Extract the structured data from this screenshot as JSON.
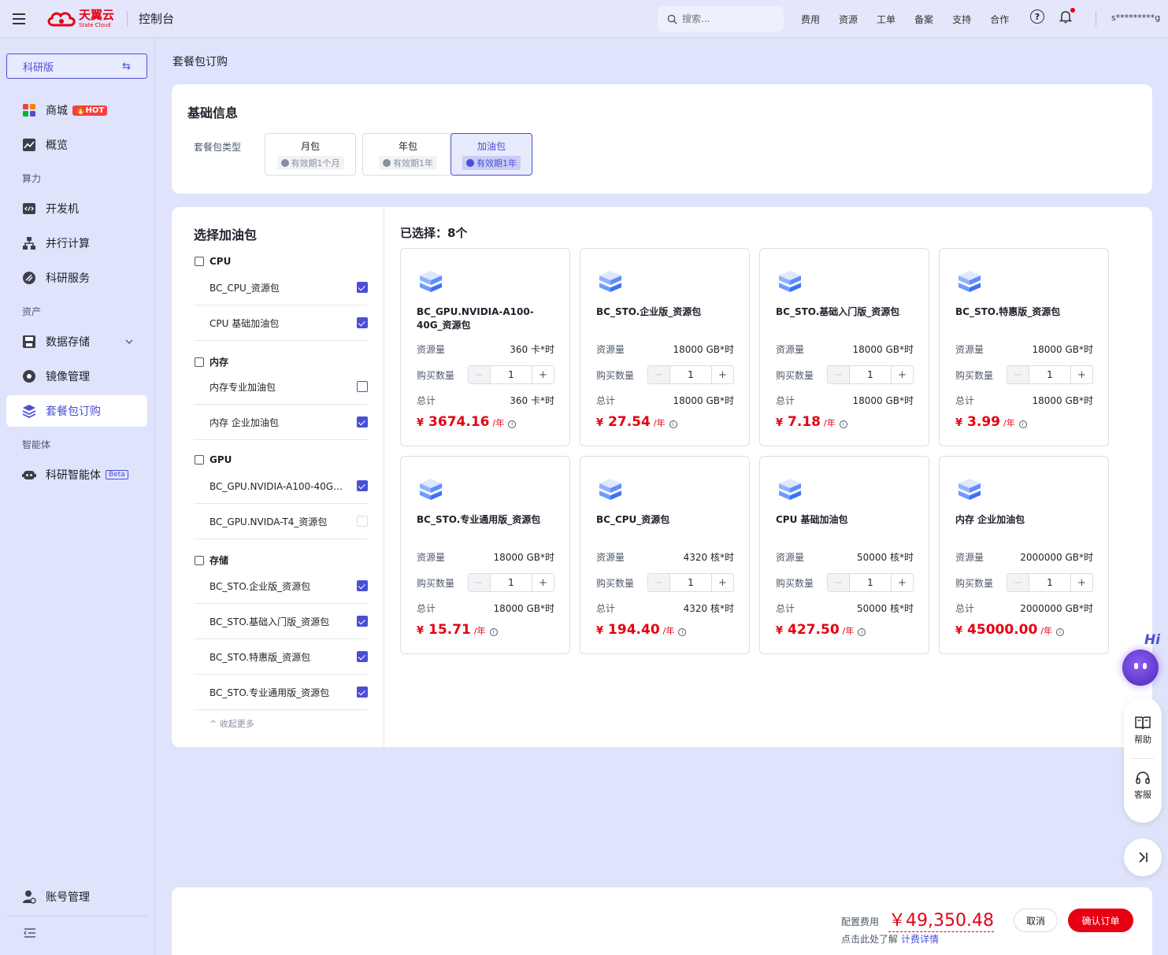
{
  "topbar": {
    "logo_cn": "天翼云",
    "logo_en": "State Cloud",
    "console_title": "控制台",
    "search_placeholder": "搜索...",
    "nav": [
      "费用",
      "资源",
      "工单",
      "备案",
      "支持",
      "合作"
    ],
    "help_glyph": "?",
    "username": "s*********g",
    "brand_color": "#e60012"
  },
  "sidebar": {
    "edition": "科研版",
    "edition_switch_glyph": "⇆",
    "items": [
      {
        "label": "商城",
        "badge": "🔥HOT",
        "icon": "apps-icon"
      },
      {
        "label": "概览",
        "icon": "chart-icon"
      },
      {
        "label": "开发机",
        "icon": "code-icon"
      },
      {
        "label": "并行计算",
        "icon": "cluster-icon"
      },
      {
        "label": "科研服务",
        "icon": "flask-icon"
      },
      {
        "label": "数据存储",
        "icon": "disk-icon"
      },
      {
        "label": "镜像管理",
        "icon": "image-icon"
      },
      {
        "label": "套餐包订购",
        "icon": "layers-icon"
      },
      {
        "label": "科研智能体",
        "badge": "Beta",
        "icon": "robot-icon"
      },
      {
        "label": "账号管理",
        "icon": "user-icon"
      }
    ],
    "groups": [
      "算力",
      "资产",
      "智能体"
    ],
    "active_item": "套餐包订购",
    "active_color": "#4a4fd6"
  },
  "breadcrumb": "套餐包订购",
  "basic": {
    "title": "基础信息",
    "type_label": "套餐包类型",
    "options": [
      {
        "name": "月包",
        "validity": "有效期1个月"
      },
      {
        "name": "年包",
        "validity": "有效期1年"
      },
      {
        "name": "加油包",
        "validity": "有效期1年"
      }
    ],
    "selected": "加油包"
  },
  "select_panel": {
    "title": "选择加油包",
    "categories": [
      {
        "name": "CPU",
        "items": [
          {
            "label": "BC_CPU_资源包",
            "checked": true
          },
          {
            "label": "CPU 基础加油包",
            "checked": true
          }
        ]
      },
      {
        "name": "内存",
        "items": [
          {
            "label": "内存专业加油包",
            "checked": false
          },
          {
            "label": "内存 企业加油包",
            "checked": true
          }
        ]
      },
      {
        "name": "GPU",
        "items": [
          {
            "label": "BC_GPU.NVIDIA-A100-40G_资源包",
            "checked": true
          },
          {
            "label": "BC_GPU.NVIDA-T4_资源包",
            "checked": false,
            "disabled": true
          }
        ]
      },
      {
        "name": "存储",
        "items": [
          {
            "label": "BC_STO.企业版_资源包",
            "checked": true
          },
          {
            "label": "BC_STO.基础入门版_资源包",
            "checked": true
          },
          {
            "label": "BC_STO.特惠版_资源包",
            "checked": true
          },
          {
            "label": "BC_STO.专业通用版_资源包",
            "checked": true
          }
        ]
      }
    ],
    "collapse_label": "收起更多"
  },
  "selected": {
    "title": "已选择：8个",
    "labels": {
      "resource": "资源量",
      "quantity": "购买数量",
      "total": "总计",
      "currency": "¥",
      "per_year": "/年",
      "minus": "−",
      "plus": "+",
      "info": "i"
    },
    "products": [
      {
        "name": "BC_GPU.NVIDIA-A100-40G_资源包",
        "resource": "360 卡*时",
        "quantity": "1",
        "total": "360 卡*时",
        "price": "3674.16"
      },
      {
        "name": "BC_STO.企业版_资源包",
        "resource": "18000 GB*时",
        "quantity": "1",
        "total": "18000 GB*时",
        "price": "27.54"
      },
      {
        "name": "BC_STO.基础入门版_资源包",
        "resource": "18000 GB*时",
        "quantity": "1",
        "total": "18000 GB*时",
        "price": "7.18"
      },
      {
        "name": "BC_STO.特惠版_资源包",
        "resource": "18000 GB*时",
        "quantity": "1",
        "total": "18000 GB*时",
        "price": "3.99"
      },
      {
        "name": "BC_STO.专业通用版_资源包",
        "resource": "18000 GB*时",
        "quantity": "1",
        "total": "18000 GB*时",
        "price": "15.71"
      },
      {
        "name": "BC_CPU_资源包",
        "resource": "4320 核*时",
        "quantity": "1",
        "total": "4320 核*时",
        "price": "194.40"
      },
      {
        "name": "CPU 基础加油包",
        "resource": "50000 核*时",
        "quantity": "1",
        "total": "50000 核*时",
        "price": "427.50"
      },
      {
        "name": "内存 企业加油包",
        "resource": "2000000 GB*时",
        "quantity": "1",
        "total": "2000000 GB*时",
        "price": "45000.00"
      }
    ]
  },
  "footer": {
    "fee_label": "配置费用",
    "fee_amount": "￥49,350.48",
    "note": "点击此处了解",
    "link": "计费详情",
    "cancel": "取消",
    "confirm": "确认订单"
  },
  "floating": {
    "hi": "Hi",
    "help": "帮助",
    "service": "客服"
  }
}
